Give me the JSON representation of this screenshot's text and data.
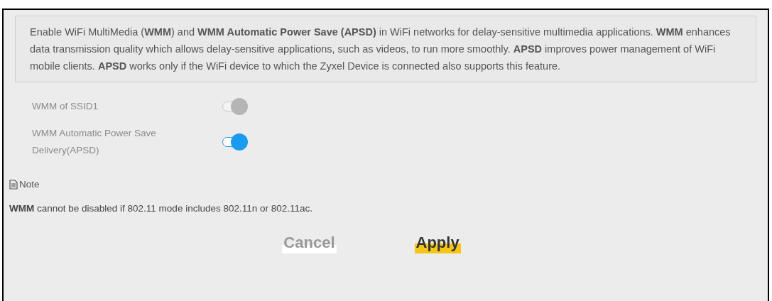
{
  "description": "Enable WiFi MultiMedia (**WMM**) and **WMM Automatic Power Save (APSD)** in WiFi networks for delay-sensitive multimedia applications. **WMM** enhances data transmission quality which allows delay-sensitive applications, such as videos, to run more smoothly. **APSD** improves power management of WiFi mobile clients. **APSD** works only if the WiFi device to which the Zyxel Device is connected also supports this feature.",
  "settings": [
    {
      "label": "WMM of SSID1",
      "on": true,
      "disabled": true
    },
    {
      "label": "WMM Automatic Power Save Delivery(APSD)",
      "on": true,
      "disabled": false
    }
  ],
  "note": {
    "title": "Note",
    "text": "**WMM** cannot be disabled if 802.11 mode includes 802.11n or 802.11ac."
  },
  "buttons": [
    {
      "label": "Cancel",
      "kind": "secondary"
    },
    {
      "label": "Apply",
      "kind": "primary"
    }
  ]
}
